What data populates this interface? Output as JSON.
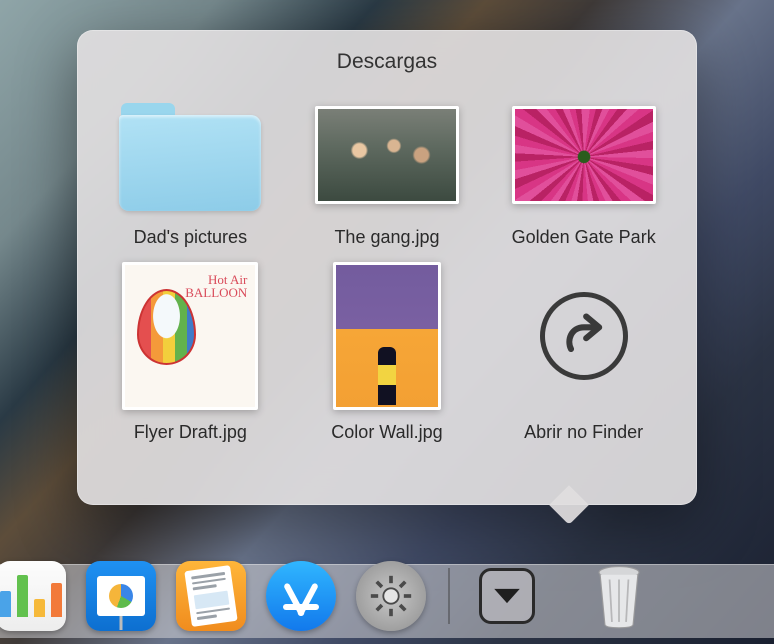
{
  "stack": {
    "title": "Descargas",
    "items": [
      {
        "label": "Dad's pictures",
        "kind": "folder"
      },
      {
        "label": "The gang.jpg",
        "kind": "image"
      },
      {
        "label": "Golden Gate Park",
        "kind": "image"
      },
      {
        "label": "Flyer Draft.jpg",
        "kind": "image"
      },
      {
        "label": "Color Wall.jpg",
        "kind": "image"
      }
    ],
    "open_in_finder_label": "Abrir no Finder"
  },
  "dock": {
    "apps": [
      {
        "name": "Numbers"
      },
      {
        "name": "Keynote"
      },
      {
        "name": "Pages"
      },
      {
        "name": "App Store"
      },
      {
        "name": "System Preferences"
      }
    ],
    "downloads_stack": "Descargas",
    "trash": "Trash"
  },
  "icons": {
    "folder": "folder-icon",
    "arrow_curve": "open-in-finder-icon",
    "chevron_down": "chevron-down-icon",
    "trash": "trash-icon",
    "gear": "gear-icon"
  },
  "colors": {
    "popup_bg": "#e1dee0",
    "folder_blue": "#8dcce8",
    "text": "#2a2a2a"
  }
}
